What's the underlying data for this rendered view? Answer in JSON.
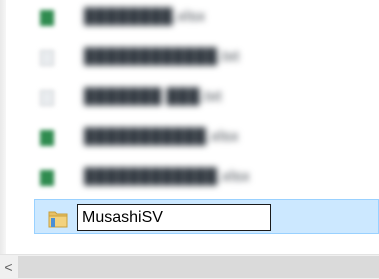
{
  "files": [
    {
      "icon": "excel-file-icon",
      "name": "████████.xlsx"
    },
    {
      "icon": "text-file-icon",
      "name": "████████████.txt"
    },
    {
      "icon": "text-file-icon",
      "name": "███████ ███.txt"
    },
    {
      "icon": "excel-file-icon",
      "name": "███████████.xlsx"
    },
    {
      "icon": "excel-file-icon",
      "name": "████████████.xlsx"
    }
  ],
  "selected": {
    "icon": "folder-icon",
    "rename_value": "MusashiSV"
  },
  "scrollbar": {
    "left_arrow": "<"
  },
  "colors": {
    "selection_bg": "#cce8ff",
    "selection_border": "#99d1ff",
    "excel_green": "#2f8b4f",
    "folder_yellow": "#e8c065"
  }
}
